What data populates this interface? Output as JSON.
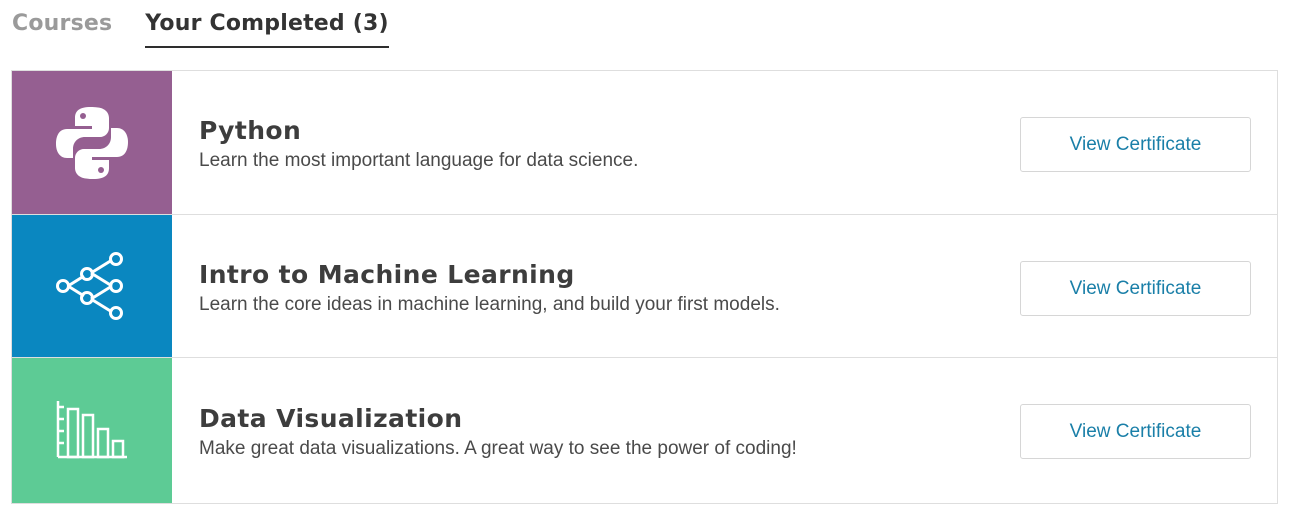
{
  "tabs": {
    "courses_label": "Courses",
    "completed_label": "Your Completed (3)"
  },
  "courses": [
    {
      "title": "Python",
      "description": "Learn the most important language for data science.",
      "button_label": "View Certificate",
      "icon": "python-icon",
      "color": "#955f91"
    },
    {
      "title": "Intro to Machine Learning",
      "description": "Learn the core ideas in machine learning, and build your first models.",
      "button_label": "View Certificate",
      "icon": "neural-network-icon",
      "color": "#0a87c0"
    },
    {
      "title": "Data Visualization",
      "description": "Make great data visualizations. A great way to see the power of coding!",
      "button_label": "View Certificate",
      "icon": "bar-chart-icon",
      "color": "#5dcb95"
    }
  ]
}
